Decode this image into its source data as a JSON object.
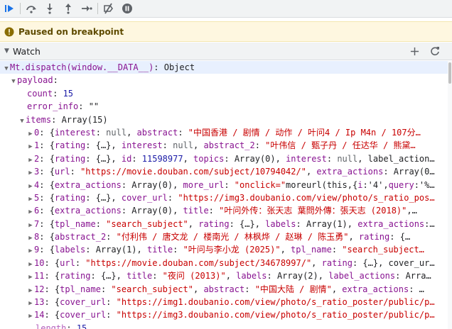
{
  "paused": {
    "text": "Paused on breakpoint"
  },
  "watch": {
    "title": "Watch"
  },
  "tree": {
    "root": {
      "expr": "Mt.dispatch(window.__DATA__)",
      "type": "Object"
    },
    "payload": {
      "key": "payload"
    },
    "count": {
      "key": "count",
      "value": "15"
    },
    "error_info": {
      "key": "error_info",
      "value": "\"\""
    },
    "items": {
      "key": "items",
      "type": "Array(15)"
    },
    "rows": [
      {
        "idx": "0",
        "text": "{interest: null, abstract: \"中国香港 / 剧情 / 动作 / 叶问4 / Ip M4n / 107分…"
      },
      {
        "idx": "1",
        "text": "{rating: {…}, interest: null, abstract_2: \"叶伟信 / 甄子丹 / 任达华 / 熊黛…"
      },
      {
        "idx": "2",
        "text": "{rating: {…}, id: 11598977, topics: Array(0), interest: null, label_action…"
      },
      {
        "idx": "3",
        "text": "{url: \"https://movie.douban.com/subject/10794042/\", extra_actions: Array(0…"
      },
      {
        "idx": "4",
        "text": "{extra_actions: Array(0), more_url: \"onclick=\"moreurl(this,{i:'4',query:'%…"
      },
      {
        "idx": "5",
        "text": "{rating: {…}, cover_url: \"https://img3.doubanio.com/view/photo/s_ratio_pos…"
      },
      {
        "idx": "6",
        "text": "{extra_actions: Array(0), title: \"叶问外传：张天志 葉問外傳：張天志 (2018)\",…"
      },
      {
        "idx": "7",
        "text": "{tpl_name: \"search_subject\", rating: {…}, labels: Array(1), extra_actions:…"
      },
      {
        "idx": "8",
        "text": "{abstract_2: \"付利伟 / 唐文龙 / 楼南光 / 林枫烨 / 赵琳 / 陈玉勇\", rating: {…"
      },
      {
        "idx": "9",
        "text": "{labels: Array(1), title: \"叶问与李小龙 (2025)\", tpl_name: \"search_subject…"
      },
      {
        "idx": "10",
        "text": "{url: \"https://movie.douban.com/subject/34678997/\", rating: {…}, cover_ur…"
      },
      {
        "idx": "11",
        "text": "{rating: {…}, title: \"夜问 (2013)\", labels: Array(2), label_actions: Arra…"
      },
      {
        "idx": "12",
        "text": "{tpl_name: \"search_subject\", abstract: \"中国大陆 / 剧情\", extra_actions: …"
      },
      {
        "idx": "13",
        "text": "{cover_url: \"https://img1.doubanio.com/view/photo/s_ratio_poster/public/p…"
      },
      {
        "idx": "14",
        "text": "{cover_url: \"https://img3.doubanio.com/view/photo/s_ratio_poster/public/p…"
      }
    ],
    "length": {
      "key": "length",
      "value": "15"
    }
  },
  "colors": {
    "accent": "#1a73e8",
    "key": "#881391",
    "string": "#c80000",
    "number": "#1a1aa6",
    "warning_bg": "#fef7e0"
  }
}
